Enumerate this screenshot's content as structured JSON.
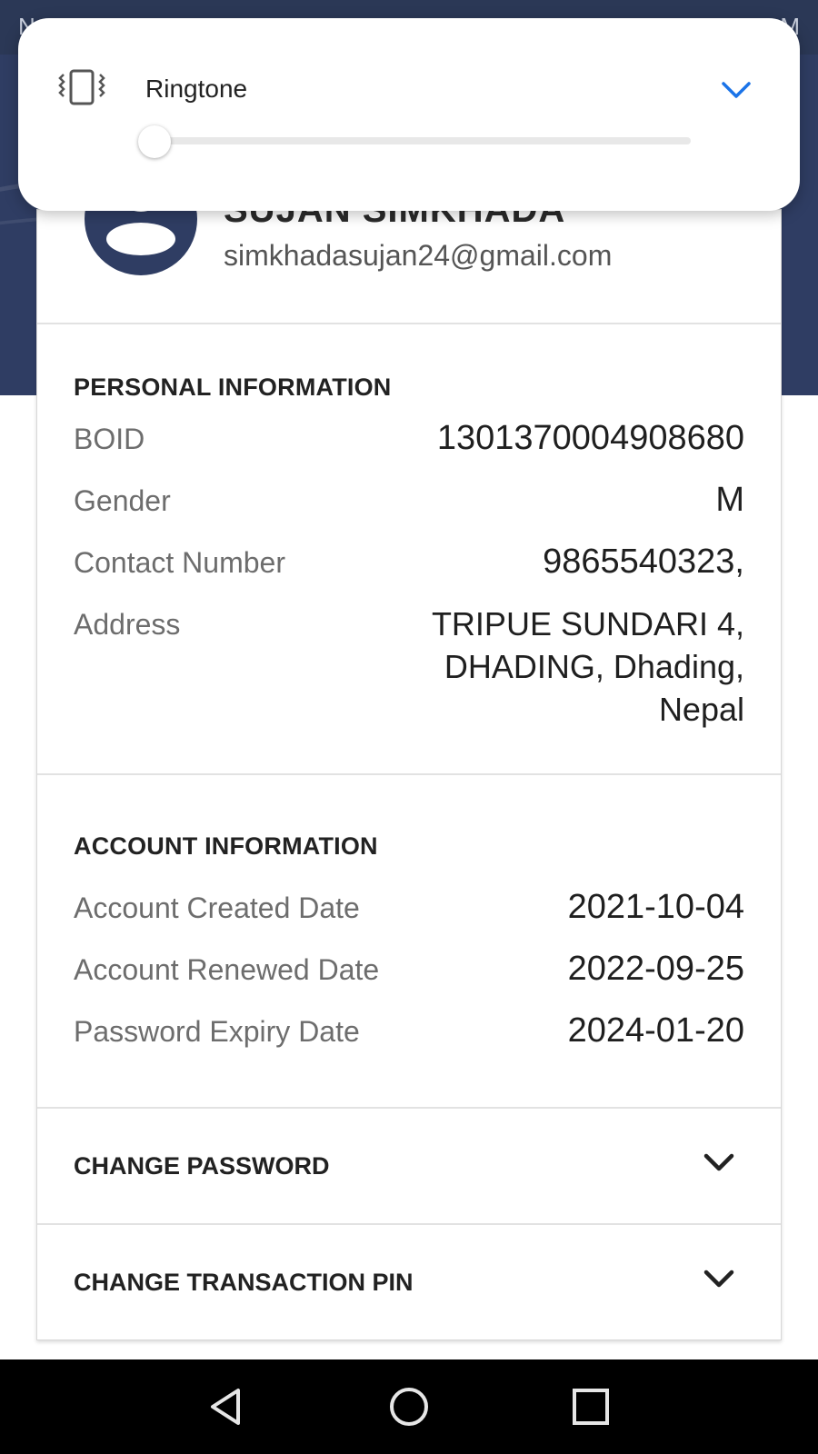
{
  "status_bar": {
    "left_text": "N",
    "right_text": "M"
  },
  "volume_panel": {
    "icon": "vibrate-icon",
    "title": "Ringtone",
    "expand_icon": "chevron-down-icon",
    "level": 0,
    "accent_color": "#1a73e8"
  },
  "profile": {
    "name": "SUJAN SIMKHADA",
    "email": "simkhadasujan24@gmail.com",
    "avatar_icon": "user-avatar-icon"
  },
  "personal_information": {
    "title": "PERSONAL INFORMATION",
    "boid": {
      "label": "BOID",
      "value": "1301370004908680"
    },
    "gender": {
      "label": "Gender",
      "value": "M"
    },
    "contact": {
      "label": "Contact Number",
      "value": "9865540323,"
    },
    "address": {
      "label": "Address",
      "lines": [
        "TRIPUE SUNDARI 4,",
        "DHADING, Dhading,",
        "Nepal"
      ]
    }
  },
  "account_information": {
    "title": "ACCOUNT INFORMATION",
    "created": {
      "label": "Account Created Date",
      "value": "2021-10-04"
    },
    "renewed": {
      "label": "Account Renewed Date",
      "value": "2022-09-25"
    },
    "expiry": {
      "label": "Password Expiry Date",
      "value": "2024-01-20"
    }
  },
  "actions": {
    "change_password": "CHANGE PASSWORD",
    "change_pin": "CHANGE TRANSACTION PIN"
  },
  "nav": {
    "back_icon": "back-icon",
    "home_icon": "home-icon",
    "recents_icon": "recents-icon"
  },
  "colors": {
    "header_bg": "#2f3d63",
    "text_primary": "#1f1f1f",
    "text_secondary": "#6d6d6d"
  }
}
